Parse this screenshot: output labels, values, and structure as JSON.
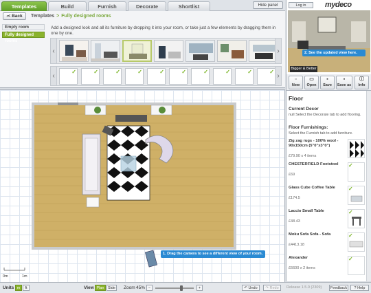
{
  "tabs": [
    {
      "label": "Templates",
      "active": true
    },
    {
      "label": "Build",
      "active": false
    },
    {
      "label": "Furnish",
      "active": false
    },
    {
      "label": "Decorate",
      "active": false
    },
    {
      "label": "Shortlist",
      "active": false
    }
  ],
  "hide_panel": "Hide panel",
  "back_label": "Back",
  "breadcrumb": {
    "root": "Templates",
    "current": "Fully designed rooms"
  },
  "sidebar_buttons": {
    "empty": "Empty room shapes",
    "full": "Fully designed rooms"
  },
  "description": "Add a designed look and all its furniture by dropping it into your room, or take just a few elements by dragging them in one by one.",
  "header": {
    "login": "Log in",
    "logo": "mydeco"
  },
  "preview": {
    "tip": "2. See the updated view here.",
    "bigger": "Bigger & Better"
  },
  "file_buttons": [
    {
      "label": "New",
      "icon": "new-icon"
    },
    {
      "label": "Open",
      "icon": "open-icon"
    },
    {
      "label": "Save",
      "icon": "save-icon"
    },
    {
      "label": "Save as",
      "icon": "save-as-icon"
    },
    {
      "label": "Info",
      "icon": "info-icon"
    }
  ],
  "floor": {
    "title": "Floor",
    "current_decor": "Current Decor",
    "current_decor_text": "null Select the Decorate tab to add flooring.",
    "furnishings": "Floor Furnishings:",
    "furnishings_text": "Select the Furnish tab to add furniture.",
    "items": [
      {
        "name": "Zig zag rugs - 100% wool - 90x150cm (5\"0\"x3\"0\")",
        "price": "£79.90 x 4 items"
      },
      {
        "name": "CHESTERFIELD Footstool",
        "price": "£69"
      },
      {
        "name": "Glass Cube Coffee Table",
        "price": "£174.5"
      },
      {
        "name": "Laccio Small Table",
        "price": "£48.43"
      },
      {
        "name": "Moku Sofa Sofa - Sofa",
        "price": "£4413.18"
      },
      {
        "name": "Alexander",
        "price": "£6600 x 2 items"
      }
    ]
  },
  "canvas_tip": "1. Drag the camera to see a different view of your room.",
  "scale": {
    "zero": "0m",
    "one": "1m"
  },
  "bottom": {
    "units": "Units",
    "unit_m": "m",
    "unit_ft": "ft",
    "view": "View",
    "plan": "Plan",
    "side": "Side",
    "zoom": "Zoom",
    "zoom_value": "45%",
    "zoom_level": 0.7,
    "undo": "Undo",
    "redo": "Redo",
    "version": "Release 1.5.0 (2309)",
    "feedback": "Feedback",
    "help": "Help"
  },
  "colors": {
    "accent_green": "#8ab32c",
    "tip_blue": "#2a8ad3",
    "floor_wood": "#cfb067"
  }
}
